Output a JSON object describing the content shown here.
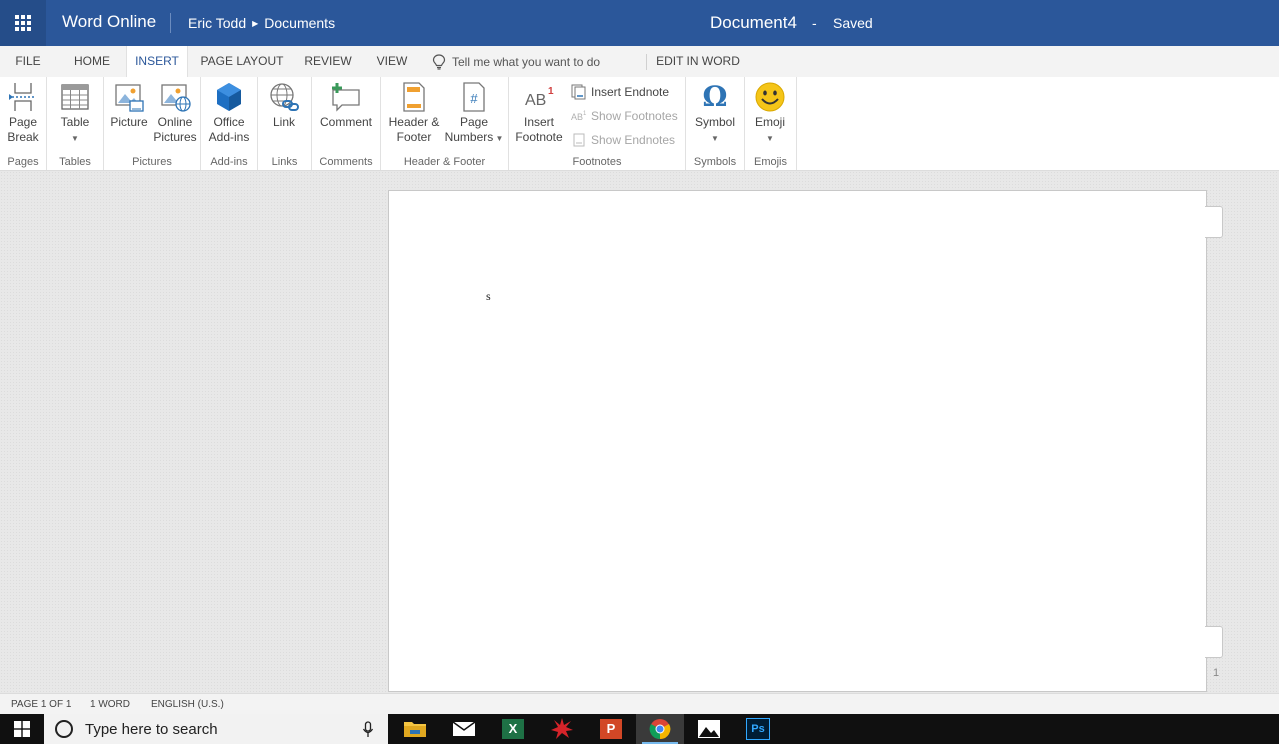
{
  "titlebar": {
    "app_name": "Word Online",
    "user": "Eric Todd",
    "location": "Documents",
    "document_name": "Document4",
    "separator": "-",
    "save_status": "Saved"
  },
  "menu": {
    "tabs": [
      {
        "label": "FILE"
      },
      {
        "label": "HOME"
      },
      {
        "label": "INSERT",
        "active": true
      },
      {
        "label": "PAGE LAYOUT"
      },
      {
        "label": "REVIEW"
      },
      {
        "label": "VIEW"
      }
    ],
    "tell_me": "Tell me what you want to do",
    "edit_in_word": "EDIT IN WORD"
  },
  "ribbon": {
    "groups": {
      "pages": "Pages",
      "tables": "Tables",
      "pictures": "Pictures",
      "addins": "Add-ins",
      "links": "Links",
      "comments": "Comments",
      "header_footer": "Header & Footer",
      "footnotes": "Footnotes",
      "symbols": "Symbols",
      "emojis": "Emojis"
    },
    "buttons": {
      "page_break_1": "Page",
      "page_break_2": "Break",
      "table": "Table",
      "picture": "Picture",
      "online_pictures_1": "Online",
      "online_pictures_2": "Pictures",
      "office_addins_1": "Office",
      "office_addins_2": "Add-ins",
      "link": "Link",
      "comment": "Comment",
      "header_footer_1": "Header &",
      "header_footer_2": "Footer",
      "page_numbers_1": "Page",
      "page_numbers_2": "Numbers",
      "insert_footnote_1": "Insert",
      "insert_footnote_2": "Footnote",
      "insert_endnote": "Insert Endnote",
      "show_footnotes": "Show Footnotes",
      "show_endnotes": "Show Endnotes",
      "symbol": "Symbol",
      "emoji": "Emoji"
    },
    "icon_text": {
      "footnote_ab": "AB",
      "footnote_sup": "1",
      "page_numbers_hash": "#",
      "omega": "Ω"
    }
  },
  "document": {
    "body_text": "s",
    "page_number": "1"
  },
  "statusbar": {
    "page": "PAGE 1 OF 1",
    "words": "1 WORD",
    "language": "ENGLISH (U.S.)"
  },
  "taskbar": {
    "search_placeholder": "Type here to search",
    "apps": [
      {
        "name": "file-explorer-icon"
      },
      {
        "name": "mail-icon"
      },
      {
        "name": "excel-icon"
      },
      {
        "name": "app-burst-icon"
      },
      {
        "name": "powerpoint-icon"
      },
      {
        "name": "chrome-icon",
        "active": true
      },
      {
        "name": "photos-icon"
      },
      {
        "name": "photoshop-icon"
      }
    ],
    "excel_letter": "X",
    "ppt_letter": "P",
    "ps_letters": "Ps"
  },
  "colors": {
    "brand_blue": "#2b579a",
    "taskbar": "#101010",
    "ribbon_icon_blue": "#2e74b5",
    "emoji_yellow": "#f5c518"
  }
}
